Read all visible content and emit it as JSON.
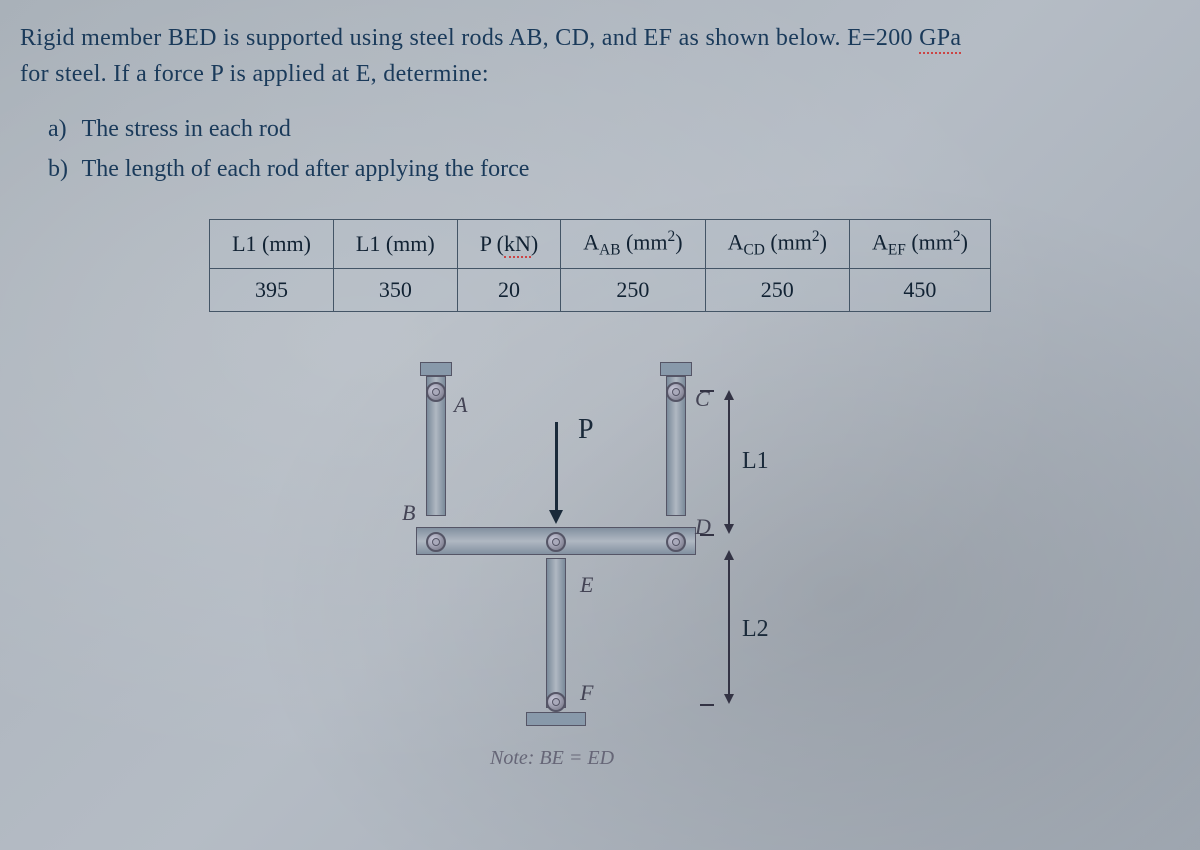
{
  "problem": {
    "line1_part1": "Rigid member BED is supported using steel rods AB, CD, and EF as shown below. E=200 ",
    "line1_gpa": "GPa",
    "line2": "for steel. If a force P is applied at E, determine:"
  },
  "tasks": {
    "a_label": "a)",
    "a_text": "The stress in each rod",
    "b_label": "b)",
    "b_text": "The length of each rod after applying the force"
  },
  "table": {
    "headers": {
      "L1": "L1 (mm)",
      "L1b": "L1 (mm)",
      "P": "P (",
      "P_kn": "kN",
      "P_close": ")",
      "AAB_pre": "A",
      "AAB_sub": "AB",
      "AAB_unit": " (mm",
      "AAB_sup": "2",
      "AAB_close": ")",
      "ACD_pre": "A",
      "ACD_sub": "CD",
      "ACD_unit": " (mm",
      "ACD_sup": "2",
      "ACD_close": ")",
      "AEF_pre": "A",
      "AEF_sub": "EF",
      "AEF_unit": " (mm",
      "AEF_sup": "2",
      "AEF_close": ")"
    },
    "values": {
      "L1": "395",
      "L1b": "350",
      "P": "20",
      "AAB": "250",
      "ACD": "250",
      "AEF": "450"
    }
  },
  "diagram": {
    "A": "A",
    "B": "B",
    "C": "C",
    "D": "D",
    "E": "E",
    "F": "F",
    "P": "P",
    "L1": "L1",
    "L2": "L2",
    "note": "Note: BE = ED"
  }
}
